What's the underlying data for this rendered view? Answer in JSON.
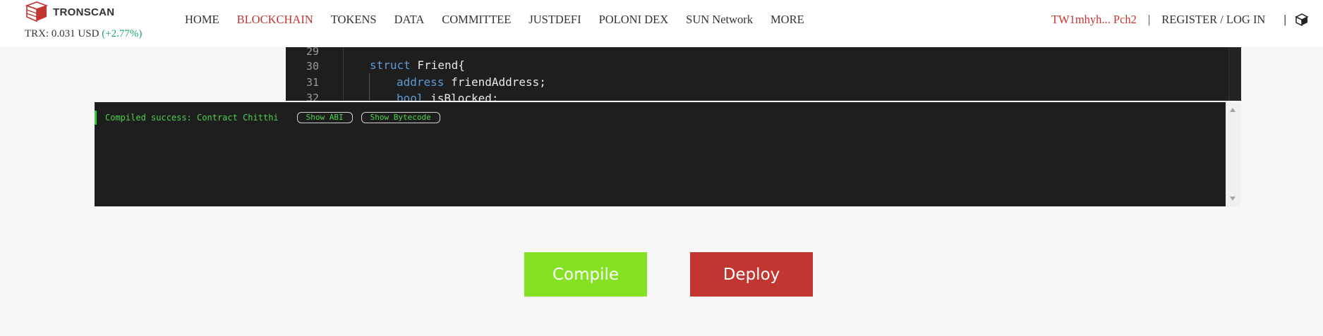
{
  "header": {
    "logo_text": "TRONSCAN",
    "price_label": "TRX: 0.031 USD",
    "price_change": "(+2.77%)",
    "nav": [
      {
        "label": "HOME",
        "active": false
      },
      {
        "label": "BLOCKCHAIN",
        "active": true
      },
      {
        "label": "TOKENS",
        "active": false
      },
      {
        "label": "DATA",
        "active": false
      },
      {
        "label": "COMMITTEE",
        "active": false
      },
      {
        "label": "JUSTDEFI",
        "active": false
      },
      {
        "label": "POLONI DEX",
        "active": false
      },
      {
        "label": "SUN Network",
        "active": false
      },
      {
        "label": "MORE",
        "active": false
      }
    ],
    "account": "TW1mhyh... Pch2",
    "separator": "|",
    "register_login": "REGISTER / LOG IN",
    "bar": "|"
  },
  "editor": {
    "lines": [
      {
        "num": "29",
        "code": ""
      },
      {
        "num": "30",
        "kw": "struct",
        "rest": " Friend{"
      },
      {
        "num": "31",
        "kw": "address",
        "rest": " friendAddress;"
      },
      {
        "num": "32",
        "kw": "bool",
        "rest": " isBlocked;"
      }
    ]
  },
  "console": {
    "message": "Compiled success: Contract Chitthi",
    "show_abi": "Show ABI",
    "show_bytecode": "Show Bytecode"
  },
  "actions": {
    "compile": "Compile",
    "deploy": "Deploy"
  },
  "colors": {
    "accent_red": "#c23631",
    "compile_green": "#84e124",
    "console_text": "#4cd24c",
    "change_green": "#1aa566"
  }
}
